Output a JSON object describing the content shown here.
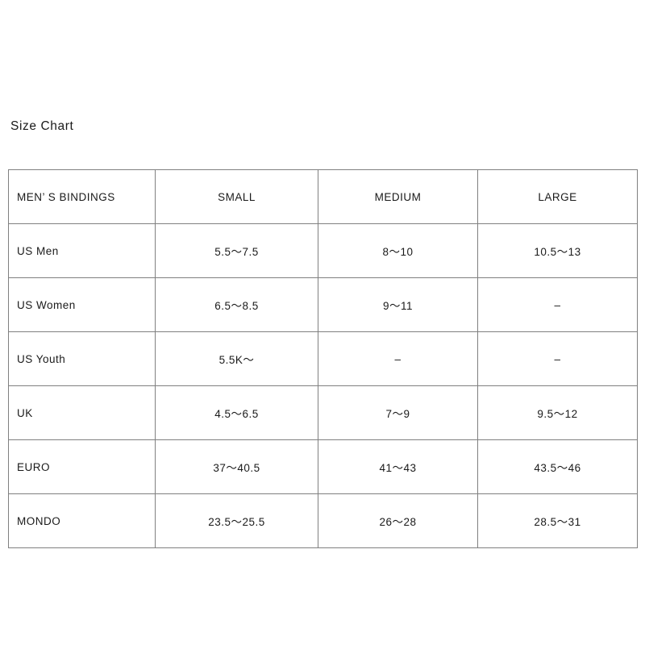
{
  "title": "Size Chart",
  "table": {
    "columns": [
      "MEN’ S BINDINGS",
      "SMALL",
      "MEDIUM",
      "LARGE"
    ],
    "rows": [
      {
        "label": "US Men",
        "small": "5.5〜7.5",
        "medium": "8〜10",
        "large": "10.5〜13"
      },
      {
        "label": "US Women",
        "small": "6.5〜8.5",
        "medium": "9〜11",
        "large": "–"
      },
      {
        "label": "US Youth",
        "small": "5.5K〜",
        "medium": "–",
        "large": "–"
      },
      {
        "label": "UK",
        "small": "4.5〜6.5",
        "medium": "7〜9",
        "large": "9.5〜12"
      },
      {
        "label": "EURO",
        "small": "37〜40.5",
        "medium": "41〜43",
        "large": "43.5〜46"
      },
      {
        "label": "MONDO",
        "small": "23.5〜25.5",
        "medium": "26〜28",
        "large": "28.5〜31"
      }
    ]
  },
  "colors": {
    "border": "#808080",
    "text": "#1a1a1a",
    "background": "#ffffff"
  }
}
